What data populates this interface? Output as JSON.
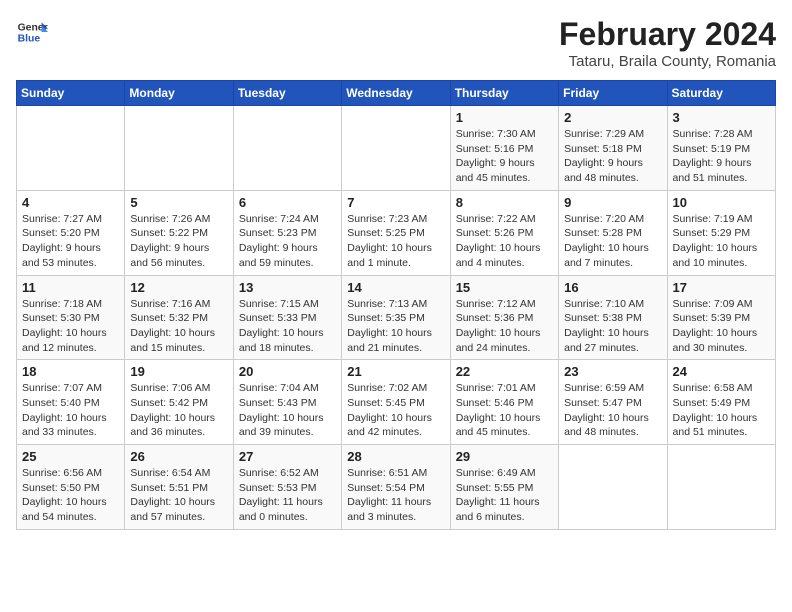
{
  "header": {
    "logo_line1": "General",
    "logo_line2": "Blue",
    "title": "February 2024",
    "subtitle": "Tataru, Braila County, Romania"
  },
  "weekdays": [
    "Sunday",
    "Monday",
    "Tuesday",
    "Wednesday",
    "Thursday",
    "Friday",
    "Saturday"
  ],
  "weeks": [
    [
      null,
      null,
      null,
      null,
      {
        "day": "1",
        "sunrise": "7:30 AM",
        "sunset": "5:16 PM",
        "daylight": "9 hours and 45 minutes."
      },
      {
        "day": "2",
        "sunrise": "7:29 AM",
        "sunset": "5:18 PM",
        "daylight": "9 hours and 48 minutes."
      },
      {
        "day": "3",
        "sunrise": "7:28 AM",
        "sunset": "5:19 PM",
        "daylight": "9 hours and 51 minutes."
      }
    ],
    [
      {
        "day": "4",
        "sunrise": "7:27 AM",
        "sunset": "5:20 PM",
        "daylight": "9 hours and 53 minutes."
      },
      {
        "day": "5",
        "sunrise": "7:26 AM",
        "sunset": "5:22 PM",
        "daylight": "9 hours and 56 minutes."
      },
      {
        "day": "6",
        "sunrise": "7:24 AM",
        "sunset": "5:23 PM",
        "daylight": "9 hours and 59 minutes."
      },
      {
        "day": "7",
        "sunrise": "7:23 AM",
        "sunset": "5:25 PM",
        "daylight": "10 hours and 1 minute."
      },
      {
        "day": "8",
        "sunrise": "7:22 AM",
        "sunset": "5:26 PM",
        "daylight": "10 hours and 4 minutes."
      },
      {
        "day": "9",
        "sunrise": "7:20 AM",
        "sunset": "5:28 PM",
        "daylight": "10 hours and 7 minutes."
      },
      {
        "day": "10",
        "sunrise": "7:19 AM",
        "sunset": "5:29 PM",
        "daylight": "10 hours and 10 minutes."
      }
    ],
    [
      {
        "day": "11",
        "sunrise": "7:18 AM",
        "sunset": "5:30 PM",
        "daylight": "10 hours and 12 minutes."
      },
      {
        "day": "12",
        "sunrise": "7:16 AM",
        "sunset": "5:32 PM",
        "daylight": "10 hours and 15 minutes."
      },
      {
        "day": "13",
        "sunrise": "7:15 AM",
        "sunset": "5:33 PM",
        "daylight": "10 hours and 18 minutes."
      },
      {
        "day": "14",
        "sunrise": "7:13 AM",
        "sunset": "5:35 PM",
        "daylight": "10 hours and 21 minutes."
      },
      {
        "day": "15",
        "sunrise": "7:12 AM",
        "sunset": "5:36 PM",
        "daylight": "10 hours and 24 minutes."
      },
      {
        "day": "16",
        "sunrise": "7:10 AM",
        "sunset": "5:38 PM",
        "daylight": "10 hours and 27 minutes."
      },
      {
        "day": "17",
        "sunrise": "7:09 AM",
        "sunset": "5:39 PM",
        "daylight": "10 hours and 30 minutes."
      }
    ],
    [
      {
        "day": "18",
        "sunrise": "7:07 AM",
        "sunset": "5:40 PM",
        "daylight": "10 hours and 33 minutes."
      },
      {
        "day": "19",
        "sunrise": "7:06 AM",
        "sunset": "5:42 PM",
        "daylight": "10 hours and 36 minutes."
      },
      {
        "day": "20",
        "sunrise": "7:04 AM",
        "sunset": "5:43 PM",
        "daylight": "10 hours and 39 minutes."
      },
      {
        "day": "21",
        "sunrise": "7:02 AM",
        "sunset": "5:45 PM",
        "daylight": "10 hours and 42 minutes."
      },
      {
        "day": "22",
        "sunrise": "7:01 AM",
        "sunset": "5:46 PM",
        "daylight": "10 hours and 45 minutes."
      },
      {
        "day": "23",
        "sunrise": "6:59 AM",
        "sunset": "5:47 PM",
        "daylight": "10 hours and 48 minutes."
      },
      {
        "day": "24",
        "sunrise": "6:58 AM",
        "sunset": "5:49 PM",
        "daylight": "10 hours and 51 minutes."
      }
    ],
    [
      {
        "day": "25",
        "sunrise": "6:56 AM",
        "sunset": "5:50 PM",
        "daylight": "10 hours and 54 minutes."
      },
      {
        "day": "26",
        "sunrise": "6:54 AM",
        "sunset": "5:51 PM",
        "daylight": "10 hours and 57 minutes."
      },
      {
        "day": "27",
        "sunrise": "6:52 AM",
        "sunset": "5:53 PM",
        "daylight": "11 hours and 0 minutes."
      },
      {
        "day": "28",
        "sunrise": "6:51 AM",
        "sunset": "5:54 PM",
        "daylight": "11 hours and 3 minutes."
      },
      {
        "day": "29",
        "sunrise": "6:49 AM",
        "sunset": "5:55 PM",
        "daylight": "11 hours and 6 minutes."
      },
      null,
      null
    ]
  ]
}
